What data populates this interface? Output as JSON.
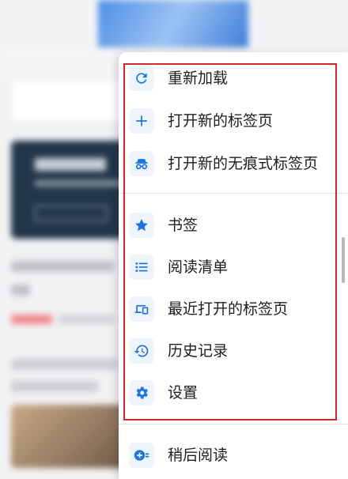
{
  "menu": {
    "items": [
      {
        "label": "重新加载",
        "icon": "reload-icon"
      },
      {
        "label": "打开新的标签页",
        "icon": "plus-icon"
      },
      {
        "label": "打开新的无痕式标签页",
        "icon": "incognito-icon"
      },
      {
        "label": "书签",
        "icon": "star-icon"
      },
      {
        "label": "阅读清单",
        "icon": "list-icon"
      },
      {
        "label": "最近打开的标签页",
        "icon": "devices-icon"
      },
      {
        "label": "历史记录",
        "icon": "history-icon"
      },
      {
        "label": "设置",
        "icon": "gear-icon"
      },
      {
        "label": "稍后阅读",
        "icon": "read-later-icon"
      }
    ]
  },
  "colors": {
    "accent": "#1a73e8",
    "highlight_border": "#d62828",
    "text": "#1d1d1f"
  }
}
